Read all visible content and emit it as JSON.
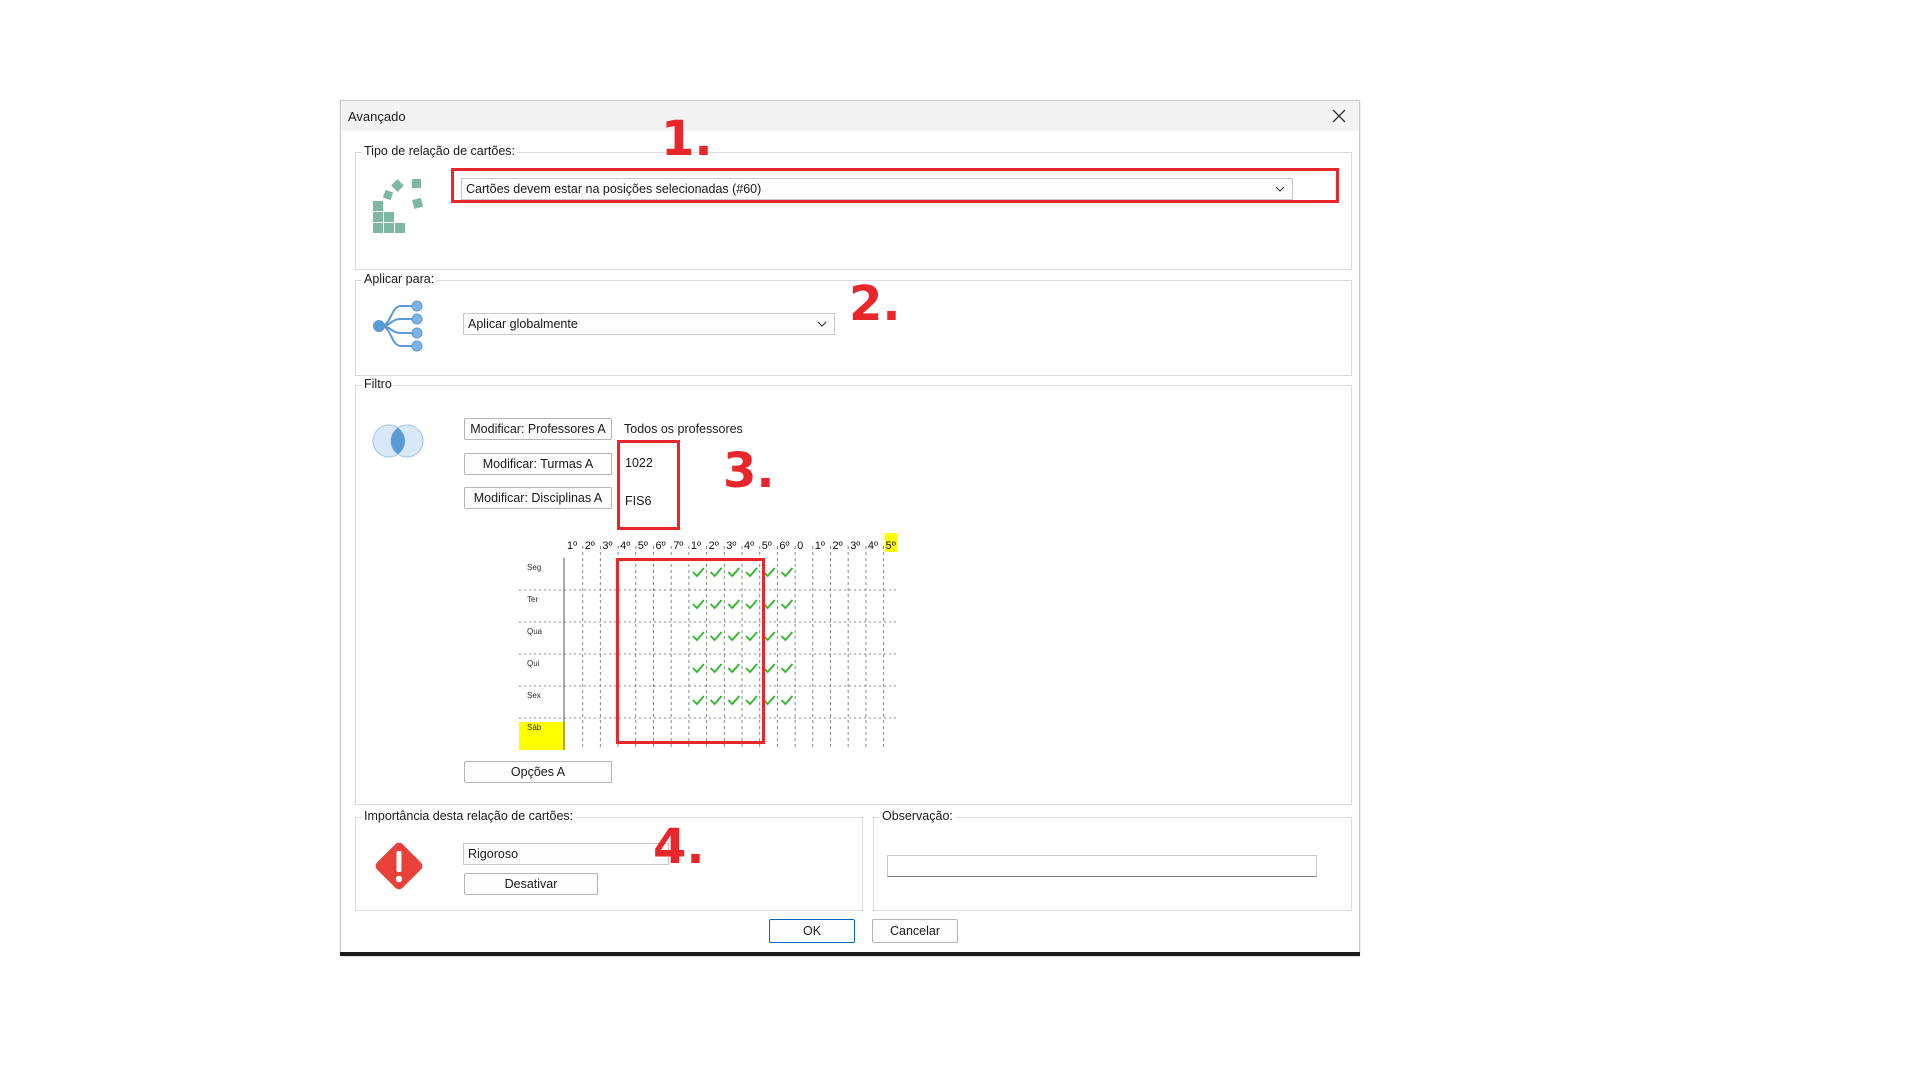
{
  "dialog": {
    "title": "Avançado",
    "ok_label": "OK",
    "cancel_label": "Cancelar"
  },
  "relation_type": {
    "label": "Tipo de relação de cartões:",
    "selected": "Cartões devem estar na posições selecionadas (#60)"
  },
  "apply_to": {
    "label": "Aplicar para:",
    "selected": "Aplicar globalmente"
  },
  "filter": {
    "label": "Filtro",
    "teachers_button": "Modificar: Professores A",
    "teachers_value": "Todos os professores",
    "classes_button": "Modificar: Turmas A",
    "classes_value": "1022",
    "subjects_button": "Modificar: Disciplinas A",
    "subjects_value": "FIS6",
    "options_button": "Opções A"
  },
  "timetable": {
    "period_headers": [
      "1º",
      "2º",
      "3º",
      "4º",
      "5º",
      "6º",
      "7º",
      "1º",
      "2º",
      "3º",
      "4º",
      "5º",
      "6º",
      "0",
      "1º",
      "2º",
      "3º",
      "4º",
      "5º"
    ],
    "highlighted_period_index": 18,
    "days": [
      "Seg",
      "Ter",
      "Qua",
      "Qui",
      "Sex",
      "Sáb"
    ],
    "highlighted_day_index": 5,
    "checked_columns": [
      7,
      8,
      9,
      10,
      11,
      12
    ],
    "checked_rows": [
      0,
      1,
      2,
      3,
      4
    ],
    "check_color": "#2db82d",
    "highlight_color": "#ffff00"
  },
  "importance": {
    "label": "Importância desta relação de cartões:",
    "selected": "Rigoroso",
    "deactivate_button": "Desativar"
  },
  "observation": {
    "label": "Observação:",
    "value": ""
  },
  "annotations": [
    "1.",
    "2.",
    "3.",
    "4."
  ],
  "colors": {
    "annotation_red": "#e8262b",
    "icon_green": "#7fb8a2",
    "icon_blue": "#5b9bd5",
    "warning_red": "#e8413a",
    "primary_blue": "#0067c0"
  }
}
